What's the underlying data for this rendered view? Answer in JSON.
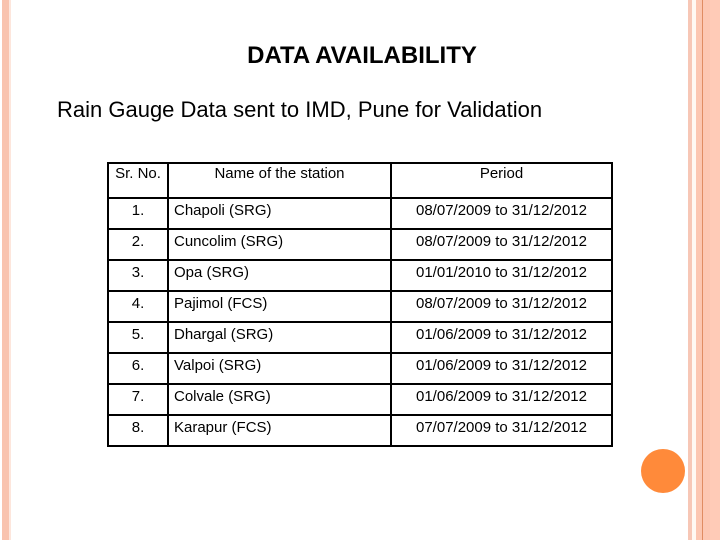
{
  "slide": {
    "title": "DATA AVAILABILITY",
    "subtitle": "Rain Gauge Data sent to  IMD, Pune for Validation",
    "accent_color": "#ff8a3a",
    "border_color": "#f9c3ae"
  },
  "table": {
    "headers": [
      "Sr. No.",
      "Name of the station",
      "Period"
    ],
    "rows": [
      {
        "sr": "1.",
        "station": "Chapoli (SRG)",
        "period": "08/07/2009 to 31/12/2012"
      },
      {
        "sr": "2.",
        "station": "Cuncolim (SRG)",
        "period": "08/07/2009 to 31/12/2012"
      },
      {
        "sr": "3.",
        "station": "Opa (SRG)",
        "period": "01/01/2010 to 31/12/2012"
      },
      {
        "sr": "4.",
        "station": "Pajimol (FCS)",
        "period": "08/07/2009 to 31/12/2012"
      },
      {
        "sr": "5.",
        "station": "Dhargal (SRG)",
        "period": "01/06/2009 to 31/12/2012"
      },
      {
        "sr": "6.",
        "station": "Valpoi (SRG)",
        "period": "01/06/2009 to 31/12/2012"
      },
      {
        "sr": "7.",
        "station": "Colvale (SRG)",
        "period": "01/06/2009 to 31/12/2012"
      },
      {
        "sr": "8.",
        "station": "Karapur (FCS)",
        "period": "07/07/2009 to 31/12/2012"
      }
    ]
  }
}
